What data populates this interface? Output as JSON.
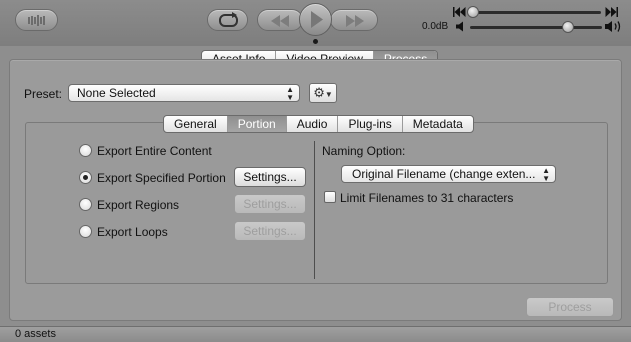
{
  "transport": {
    "volume_label": "0.0dB"
  },
  "main_tabs": [
    {
      "label": "Asset Info",
      "selected": false
    },
    {
      "label": "Video Preview",
      "selected": false
    },
    {
      "label": "Process",
      "selected": true
    }
  ],
  "preset": {
    "label": "Preset:",
    "value": "None Selected"
  },
  "sub_tabs": [
    {
      "label": "General",
      "selected": false
    },
    {
      "label": "Portion",
      "selected": true
    },
    {
      "label": "Audio",
      "selected": false
    },
    {
      "label": "Plug-ins",
      "selected": false
    },
    {
      "label": "Metadata",
      "selected": false
    }
  ],
  "export_options": [
    {
      "label": "Export Entire Content",
      "checked": false,
      "settings": null
    },
    {
      "label": "Export Specified Portion",
      "checked": true,
      "settings": {
        "label": "Settings...",
        "enabled": true
      }
    },
    {
      "label": "Export Regions",
      "checked": false,
      "settings": {
        "label": "Settings...",
        "enabled": false
      }
    },
    {
      "label": "Export Loops",
      "checked": false,
      "settings": {
        "label": "Settings...",
        "enabled": false
      }
    }
  ],
  "naming": {
    "label": "Naming Option:",
    "value": "Original Filename (change exten...",
    "limit_label": "Limit Filenames to 31 characters",
    "limit_checked": false
  },
  "process_button": {
    "label": "Process",
    "enabled": false
  },
  "status": {
    "text": "0 assets"
  }
}
